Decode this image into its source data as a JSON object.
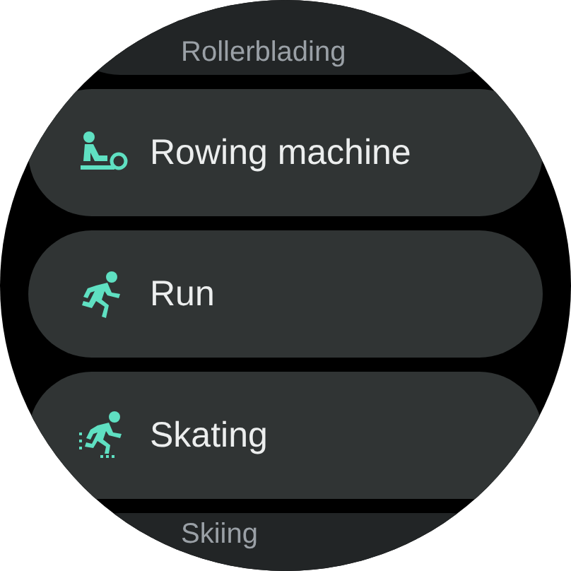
{
  "exercises": [
    {
      "label": "Rollerblading",
      "faded": true
    },
    {
      "label": "Rowing machine",
      "faded": false
    },
    {
      "label": "Run",
      "faded": false
    },
    {
      "label": "Skating",
      "faded": false
    },
    {
      "label": "Skiing",
      "faded": true
    }
  ]
}
